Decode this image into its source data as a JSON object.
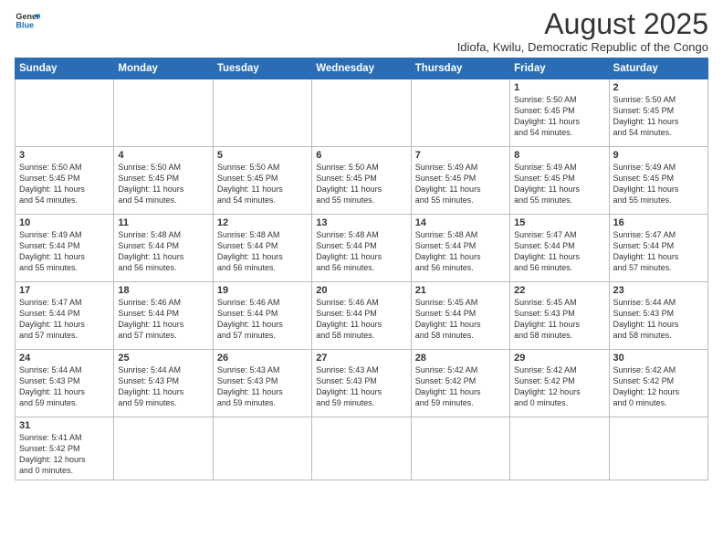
{
  "header": {
    "logo_line1": "General",
    "logo_line2": "Blue",
    "month": "August 2025",
    "location": "Idiofa, Kwilu, Democratic Republic of the Congo"
  },
  "weekdays": [
    "Sunday",
    "Monday",
    "Tuesday",
    "Wednesday",
    "Thursday",
    "Friday",
    "Saturday"
  ],
  "weeks": [
    [
      {
        "day": "",
        "info": ""
      },
      {
        "day": "",
        "info": ""
      },
      {
        "day": "",
        "info": ""
      },
      {
        "day": "",
        "info": ""
      },
      {
        "day": "",
        "info": ""
      },
      {
        "day": "1",
        "info": "Sunrise: 5:50 AM\nSunset: 5:45 PM\nDaylight: 11 hours\nand 54 minutes."
      },
      {
        "day": "2",
        "info": "Sunrise: 5:50 AM\nSunset: 5:45 PM\nDaylight: 11 hours\nand 54 minutes."
      }
    ],
    [
      {
        "day": "3",
        "info": "Sunrise: 5:50 AM\nSunset: 5:45 PM\nDaylight: 11 hours\nand 54 minutes."
      },
      {
        "day": "4",
        "info": "Sunrise: 5:50 AM\nSunset: 5:45 PM\nDaylight: 11 hours\nand 54 minutes."
      },
      {
        "day": "5",
        "info": "Sunrise: 5:50 AM\nSunset: 5:45 PM\nDaylight: 11 hours\nand 54 minutes."
      },
      {
        "day": "6",
        "info": "Sunrise: 5:50 AM\nSunset: 5:45 PM\nDaylight: 11 hours\nand 55 minutes."
      },
      {
        "day": "7",
        "info": "Sunrise: 5:49 AM\nSunset: 5:45 PM\nDaylight: 11 hours\nand 55 minutes."
      },
      {
        "day": "8",
        "info": "Sunrise: 5:49 AM\nSunset: 5:45 PM\nDaylight: 11 hours\nand 55 minutes."
      },
      {
        "day": "9",
        "info": "Sunrise: 5:49 AM\nSunset: 5:45 PM\nDaylight: 11 hours\nand 55 minutes."
      }
    ],
    [
      {
        "day": "10",
        "info": "Sunrise: 5:49 AM\nSunset: 5:44 PM\nDaylight: 11 hours\nand 55 minutes."
      },
      {
        "day": "11",
        "info": "Sunrise: 5:48 AM\nSunset: 5:44 PM\nDaylight: 11 hours\nand 56 minutes."
      },
      {
        "day": "12",
        "info": "Sunrise: 5:48 AM\nSunset: 5:44 PM\nDaylight: 11 hours\nand 56 minutes."
      },
      {
        "day": "13",
        "info": "Sunrise: 5:48 AM\nSunset: 5:44 PM\nDaylight: 11 hours\nand 56 minutes."
      },
      {
        "day": "14",
        "info": "Sunrise: 5:48 AM\nSunset: 5:44 PM\nDaylight: 11 hours\nand 56 minutes."
      },
      {
        "day": "15",
        "info": "Sunrise: 5:47 AM\nSunset: 5:44 PM\nDaylight: 11 hours\nand 56 minutes."
      },
      {
        "day": "16",
        "info": "Sunrise: 5:47 AM\nSunset: 5:44 PM\nDaylight: 11 hours\nand 57 minutes."
      }
    ],
    [
      {
        "day": "17",
        "info": "Sunrise: 5:47 AM\nSunset: 5:44 PM\nDaylight: 11 hours\nand 57 minutes."
      },
      {
        "day": "18",
        "info": "Sunrise: 5:46 AM\nSunset: 5:44 PM\nDaylight: 11 hours\nand 57 minutes."
      },
      {
        "day": "19",
        "info": "Sunrise: 5:46 AM\nSunset: 5:44 PM\nDaylight: 11 hours\nand 57 minutes."
      },
      {
        "day": "20",
        "info": "Sunrise: 5:46 AM\nSunset: 5:44 PM\nDaylight: 11 hours\nand 58 minutes."
      },
      {
        "day": "21",
        "info": "Sunrise: 5:45 AM\nSunset: 5:44 PM\nDaylight: 11 hours\nand 58 minutes."
      },
      {
        "day": "22",
        "info": "Sunrise: 5:45 AM\nSunset: 5:43 PM\nDaylight: 11 hours\nand 58 minutes."
      },
      {
        "day": "23",
        "info": "Sunrise: 5:44 AM\nSunset: 5:43 PM\nDaylight: 11 hours\nand 58 minutes."
      }
    ],
    [
      {
        "day": "24",
        "info": "Sunrise: 5:44 AM\nSunset: 5:43 PM\nDaylight: 11 hours\nand 59 minutes."
      },
      {
        "day": "25",
        "info": "Sunrise: 5:44 AM\nSunset: 5:43 PM\nDaylight: 11 hours\nand 59 minutes."
      },
      {
        "day": "26",
        "info": "Sunrise: 5:43 AM\nSunset: 5:43 PM\nDaylight: 11 hours\nand 59 minutes."
      },
      {
        "day": "27",
        "info": "Sunrise: 5:43 AM\nSunset: 5:43 PM\nDaylight: 11 hours\nand 59 minutes."
      },
      {
        "day": "28",
        "info": "Sunrise: 5:42 AM\nSunset: 5:42 PM\nDaylight: 11 hours\nand 59 minutes."
      },
      {
        "day": "29",
        "info": "Sunrise: 5:42 AM\nSunset: 5:42 PM\nDaylight: 12 hours\nand 0 minutes."
      },
      {
        "day": "30",
        "info": "Sunrise: 5:42 AM\nSunset: 5:42 PM\nDaylight: 12 hours\nand 0 minutes."
      }
    ],
    [
      {
        "day": "31",
        "info": "Sunrise: 5:41 AM\nSunset: 5:42 PM\nDaylight: 12 hours\nand 0 minutes."
      },
      {
        "day": "",
        "info": ""
      },
      {
        "day": "",
        "info": ""
      },
      {
        "day": "",
        "info": ""
      },
      {
        "day": "",
        "info": ""
      },
      {
        "day": "",
        "info": ""
      },
      {
        "day": "",
        "info": ""
      }
    ]
  ]
}
